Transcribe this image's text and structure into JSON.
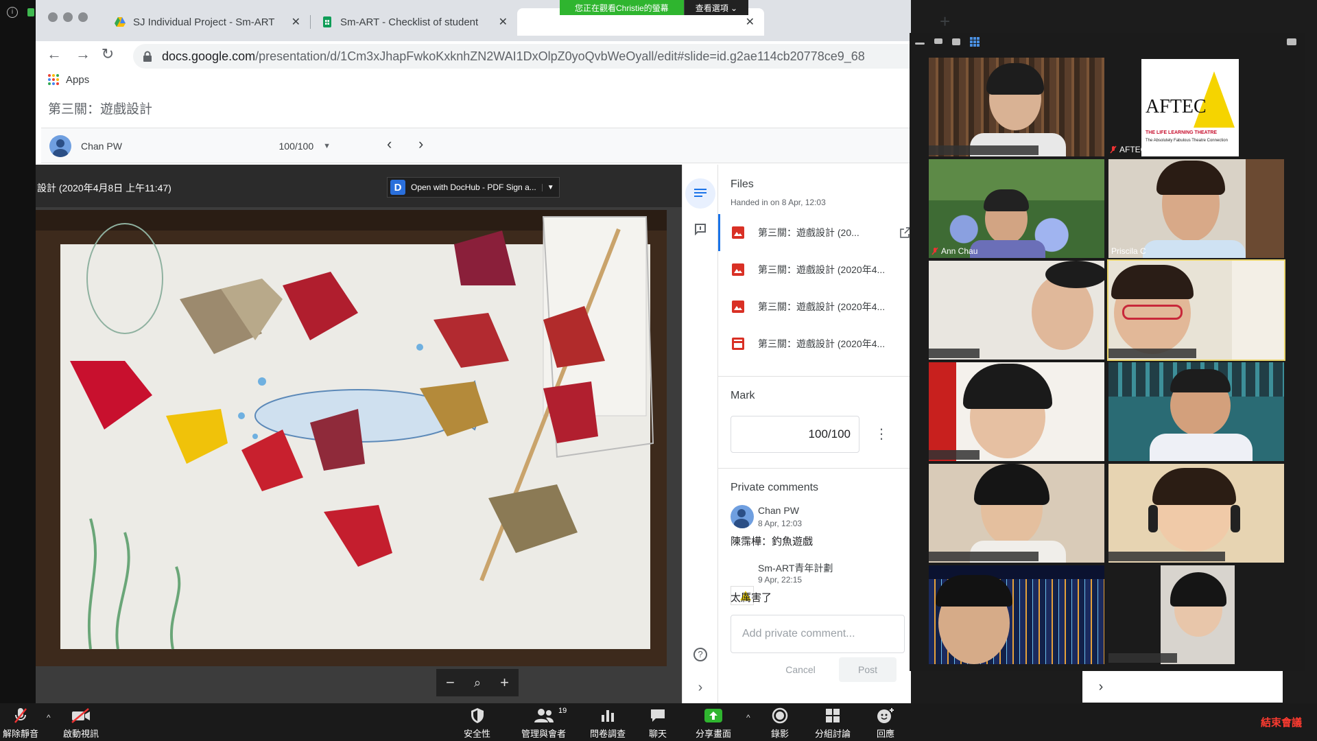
{
  "browser": {
    "tabs": [
      {
        "title": "SJ Individual Project - Sm-ART"
      },
      {
        "title": "Sm-ART - Checklist of student"
      }
    ],
    "url_domain": "docs.google.com",
    "url_path": "/presentation/d/1Cm3xJhapFwkoKxknhZN2WAI1DxOlpZ0yoQvbWeOyall/edit#slide=id.g2ae114cb20778ce9_68",
    "bookmarks": [
      {
        "label": "Apps"
      }
    ],
    "doc_title": "第三關：遊戲設計"
  },
  "grader": {
    "student_name": "Chan PW",
    "student_grade": "100/100",
    "viewer_filename": "設計 (2020年4月8日 上午11:47)",
    "open_with": "Open with DocHub - PDF Sign a..."
  },
  "files_panel": {
    "heading": "Files",
    "handed_in": "Handed in on 8 Apr, 12:03",
    "files": [
      {
        "name": "第三關：遊戲設計 (20...",
        "type": "image",
        "selected": true
      },
      {
        "name": "第三關：遊戲設計 (2020年4...",
        "type": "image",
        "selected": false
      },
      {
        "name": "第三關：遊戲設計 (2020年4...",
        "type": "image",
        "selected": false
      },
      {
        "name": "第三關：遊戲設計 (2020年4...",
        "type": "video",
        "selected": false
      }
    ],
    "mark_heading": "Mark",
    "mark_value": "100/100",
    "private_comments_heading": "Private comments",
    "comments": [
      {
        "author": "Chan PW",
        "date": "8 Apr, 12:03",
        "text": "陳霈樺：釣魚遊戲"
      },
      {
        "author": "Sm-ART青年計劃",
        "date": "9 Apr, 22:15",
        "text": "太厲害了"
      }
    ],
    "comment_placeholder": "Add private comment...",
    "cancel_label": "Cancel",
    "post_label": "Post"
  },
  "zoom": {
    "share_banner": "您正在觀看Christie的螢幕",
    "view_options": "查看選項 ⌄",
    "participants": [
      {
        "name": ""
      },
      {
        "name": "AFTEC",
        "muted": true
      },
      {
        "name": "Ann Chau",
        "muted": true
      },
      {
        "name": "Priscila C"
      },
      {
        "name": ""
      },
      {
        "name": ""
      },
      {
        "name": ""
      },
      {
        "name": ""
      },
      {
        "name": ""
      },
      {
        "name": ""
      },
      {
        "name": ""
      },
      {
        "name": ""
      }
    ],
    "aftec_logo_text": "AFTEC",
    "aftec_tagline": "THE LIFE LEARNING THEATRE",
    "aftec_tagline2": "The Absolutely Fabulous Theatre Connection",
    "toolbar": {
      "unmute": "解除靜音",
      "start_video": "啟動視訊",
      "security": "安全性",
      "participants": "管理與會者",
      "participant_count": "19",
      "polls": "問卷調查",
      "chat": "聊天",
      "share": "分享畫面",
      "record": "錄影",
      "breakout": "分組討論",
      "reactions": "回應",
      "end": "結束會議"
    }
  },
  "colors": {
    "zoom_green": "#2fb52f",
    "google_blue": "#1a73e8",
    "end_red": "#ff3b30",
    "speaking_border": "#e9d46a"
  }
}
